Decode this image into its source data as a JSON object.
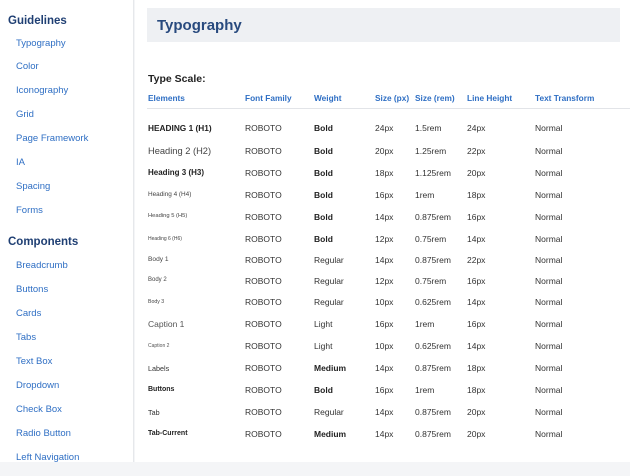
{
  "sidebar": {
    "guidelines_heading": "Guidelines",
    "guidelines": [
      "Typography",
      "Color",
      "Iconography",
      "Grid",
      "Page Framework",
      "IA",
      "Spacing",
      "Forms"
    ],
    "components_heading": "Components",
    "components": [
      "Breadcrumb",
      "Buttons",
      "Cards",
      "Tabs",
      "Text Box",
      "Dropdown",
      "Check Box",
      "Radio Button",
      "Left Navigation"
    ]
  },
  "main": {
    "title": "Typography",
    "section_title": "Type Scale:",
    "columns": [
      "Elements",
      "Font Family",
      "Weight",
      "Size (px)",
      "Size (rem)",
      "Line Height",
      "Text Transform"
    ],
    "rows": [
      {
        "element": "HEADING 1 (H1)",
        "family": "ROBOTO",
        "weight": "Bold",
        "px": "24px",
        "rem": "1.5rem",
        "line": "24px",
        "transform": "Normal"
      },
      {
        "element": "Heading 2 (H2)",
        "family": "ROBOTO",
        "weight": "Bold",
        "px": "20px",
        "rem": "1.25rem",
        "line": "22px",
        "transform": "Normal"
      },
      {
        "element": "Heading 3 (H3)",
        "family": "ROBOTO",
        "weight": "Bold",
        "px": "18px",
        "rem": "1.125rem",
        "line": "20px",
        "transform": "Normal"
      },
      {
        "element": "Heading 4 (H4)",
        "family": "ROBOTO",
        "weight": "Bold",
        "px": "16px",
        "rem": "1rem",
        "line": "18px",
        "transform": "Normal"
      },
      {
        "element": "Heading 5 (H5)",
        "family": "ROBOTO",
        "weight": "Bold",
        "px": "14px",
        "rem": "0.875rem",
        "line": "16px",
        "transform": "Normal"
      },
      {
        "element": "Heading 6 (H6)",
        "family": "ROBOTO",
        "weight": "Bold",
        "px": "12px",
        "rem": "0.75rem",
        "line": "14px",
        "transform": "Normal"
      },
      {
        "element": "Body 1",
        "family": "ROBOTO",
        "weight": "Regular",
        "px": "14px",
        "rem": "0.875rem",
        "line": "22px",
        "transform": "Normal"
      },
      {
        "element": "Body 2",
        "family": "ROBOTO",
        "weight": "Regular",
        "px": "12px",
        "rem": "0.75rem",
        "line": "16px",
        "transform": "Normal"
      },
      {
        "element": "Body 3",
        "family": "ROBOTO",
        "weight": "Regular",
        "px": "10px",
        "rem": "0.625rem",
        "line": "14px",
        "transform": "Normal"
      },
      {
        "element": "Caption 1",
        "family": "ROBOTO",
        "weight": "Light",
        "px": "16px",
        "rem": "1rem",
        "line": "16px",
        "transform": "Normal"
      },
      {
        "element": "Caption 2",
        "family": "ROBOTO",
        "weight": "Light",
        "px": "10px",
        "rem": "0.625rem",
        "line": "14px",
        "transform": "Normal"
      },
      {
        "element": "Labels",
        "family": "ROBOTO",
        "weight": "Medium",
        "px": "14px",
        "rem": "0.875rem",
        "line": "18px",
        "transform": "Normal"
      },
      {
        "element": "Buttons",
        "family": "ROBOTO",
        "weight": "Bold",
        "px": "16px",
        "rem": "1rem",
        "line": "18px",
        "transform": "Normal"
      },
      {
        "element": "Tab",
        "family": "ROBOTO",
        "weight": "Regular",
        "px": "14px",
        "rem": "0.875rem",
        "line": "20px",
        "transform": "Normal"
      },
      {
        "element": "Tab-Current",
        "family": "ROBOTO",
        "weight": "Medium",
        "px": "14px",
        "rem": "0.875rem",
        "line": "20px",
        "transform": "Normal"
      }
    ]
  }
}
